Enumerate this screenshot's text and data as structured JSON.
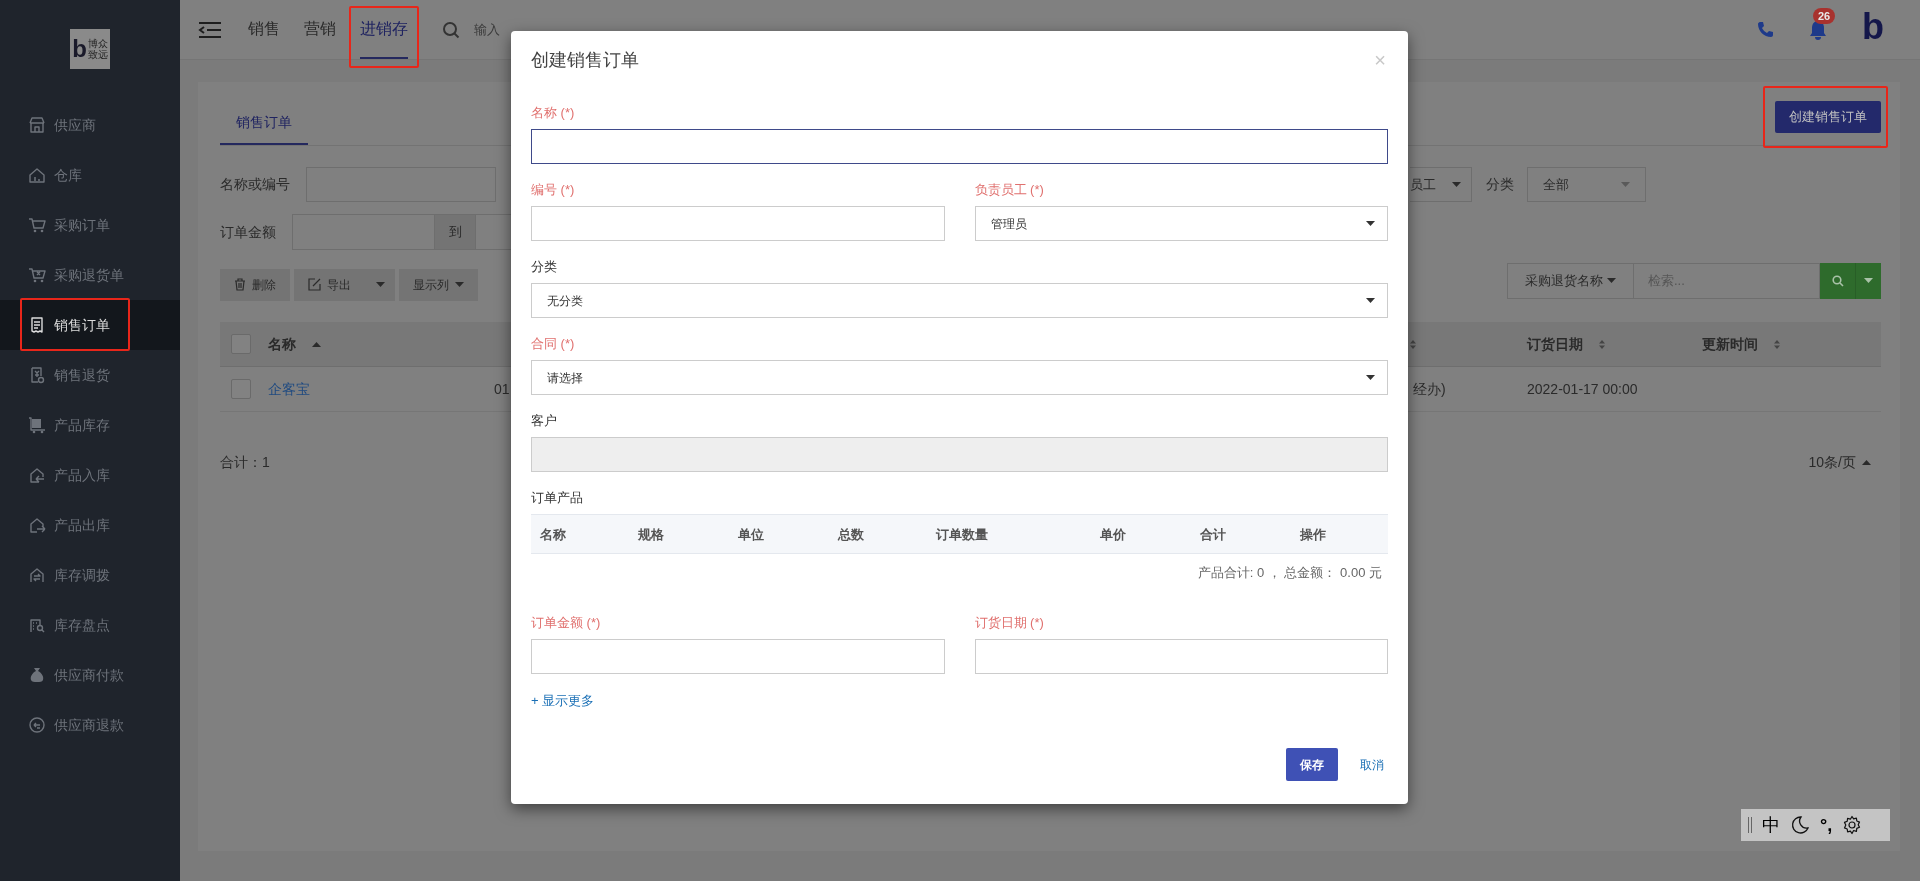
{
  "sidebar": {
    "logo": {
      "mark": "b",
      "lines": [
        "博众",
        "致远"
      ]
    },
    "items": [
      {
        "label": "供应商",
        "selected": false,
        "highlighted": false
      },
      {
        "label": "仓库",
        "selected": false,
        "highlighted": false
      },
      {
        "label": "采购订单",
        "selected": false,
        "highlighted": false
      },
      {
        "label": "采购退货单",
        "selected": false,
        "highlighted": false
      },
      {
        "label": "销售订单",
        "selected": true,
        "highlighted": true
      },
      {
        "label": "销售退货",
        "selected": false,
        "highlighted": false
      },
      {
        "label": "产品库存",
        "selected": false,
        "highlighted": false
      },
      {
        "label": "产品入库",
        "selected": false,
        "highlighted": false
      },
      {
        "label": "产品出库",
        "selected": false,
        "highlighted": false
      },
      {
        "label": "库存调拨",
        "selected": false,
        "highlighted": false
      },
      {
        "label": "库存盘点",
        "selected": false,
        "highlighted": false
      },
      {
        "label": "供应商付款",
        "selected": false,
        "highlighted": false
      },
      {
        "label": "供应商退款",
        "selected": false,
        "highlighted": false
      }
    ]
  },
  "top_bar": {
    "nav": [
      {
        "label": "销售",
        "selected": false,
        "highlighted": false
      },
      {
        "label": "营销",
        "selected": false,
        "highlighted": false
      },
      {
        "label": "进销存",
        "selected": true,
        "highlighted": true
      }
    ],
    "search": {
      "placeholder": "输入"
    },
    "notifications": {
      "badge": "26"
    },
    "brand_mark": "b"
  },
  "page": {
    "tabs": [
      {
        "label": "销售订单",
        "selected": true
      }
    ],
    "create_button": {
      "label": "创建销售订单",
      "highlighted": true
    },
    "filters": {
      "name_label": "名称或编号",
      "staff_select": "员工",
      "category_label": "分类",
      "category_select": "全部",
      "amount_label": "订单金额",
      "range_separator": "到"
    },
    "toolbar": [
      {
        "label": "删除",
        "kind": "plain"
      },
      {
        "label": "导出",
        "kind": "split"
      },
      {
        "label": "显示列",
        "kind": "dropdown"
      }
    ],
    "search": {
      "field_select": "采购退货名称",
      "placeholder": "检索..."
    },
    "table": {
      "header_checked": false,
      "left_columns": [
        {
          "label": "名称",
          "kind": "sorted"
        }
      ],
      "right_columns": [
        {
          "kind": "sortable"
        },
        {
          "label": "订货日期",
          "kind": "sortable"
        },
        {
          "label": "更新时间",
          "kind": "sortable"
        }
      ],
      "rows": [
        {
          "checked": false,
          "name": "企客宝",
          "code": "01",
          "handler": "经办)",
          "order_date": "2022-01-17 00:00"
        }
      ]
    },
    "total": "合计：1",
    "page_size": "10条/页"
  },
  "dialog": {
    "title": "创建销售订单",
    "close": "×",
    "rows": [
      [
        {
          "label": "名称 (*)",
          "required": true,
          "kind": "text",
          "focused": true
        }
      ],
      [
        {
          "label": "编号 (*)",
          "required": true,
          "kind": "text",
          "focused": false
        },
        {
          "label": "负责员工 (*)",
          "required": true,
          "kind": "select",
          "value": "管理员",
          "focused": false
        }
      ],
      [
        {
          "label": "分类",
          "required": false,
          "kind": "select",
          "value": "无分类",
          "focused": false
        }
      ],
      [
        {
          "label": "合同 (*)",
          "required": true,
          "kind": "select",
          "value": "请选择",
          "focused": false
        }
      ],
      [
        {
          "label": "客户",
          "required": false,
          "kind": "disabled",
          "focused": false
        }
      ]
    ],
    "products": {
      "label": "订单产品",
      "columns": [
        "名称",
        "规格",
        "单位",
        "总数",
        "订单数量",
        "单价",
        "合计",
        "操作"
      ],
      "summary": "产品合计: 0 ， 总金额： 0.00 元"
    },
    "bottom_rows": [
      [
        {
          "label": "订单金额 (*)",
          "required": true,
          "kind": "text",
          "focused": false
        },
        {
          "label": "订货日期 (*)",
          "required": true,
          "kind": "text",
          "focused": false
        }
      ]
    ],
    "more_link": "+ 显示更多",
    "save": "保存",
    "cancel": "取消"
  },
  "ime_bar": {
    "mode": "中",
    "punctuation": "°,"
  }
}
